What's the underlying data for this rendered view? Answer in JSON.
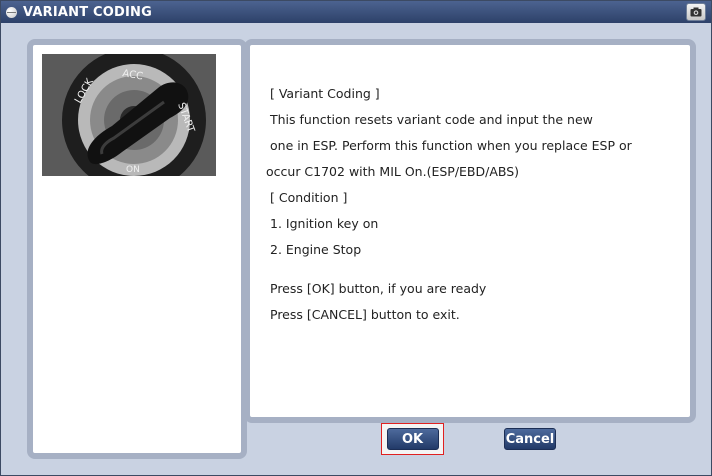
{
  "window": {
    "title": "VARIANT CODING",
    "title_icon": "hardware-icon",
    "camera_icon": "camera-icon"
  },
  "image": {
    "icon": "ignition-key-photo",
    "labels": [
      "LOCK",
      "ACC",
      "START",
      "ON"
    ]
  },
  "content": {
    "lines": [
      "[ Variant Coding ]",
      "This function resets variant code and input the new",
      "one in ESP. Perform this function when you replace ESP or",
      "occur C1702 with MIL On.(ESP/EBD/ABS)",
      "[ Condition ]",
      "1. Ignition key on",
      "2. Engine Stop",
      "Press [OK] button, if you are ready",
      "Press [CANCEL] button to exit."
    ]
  },
  "buttons": {
    "ok_label": "OK",
    "cancel_label": "Cancel"
  }
}
